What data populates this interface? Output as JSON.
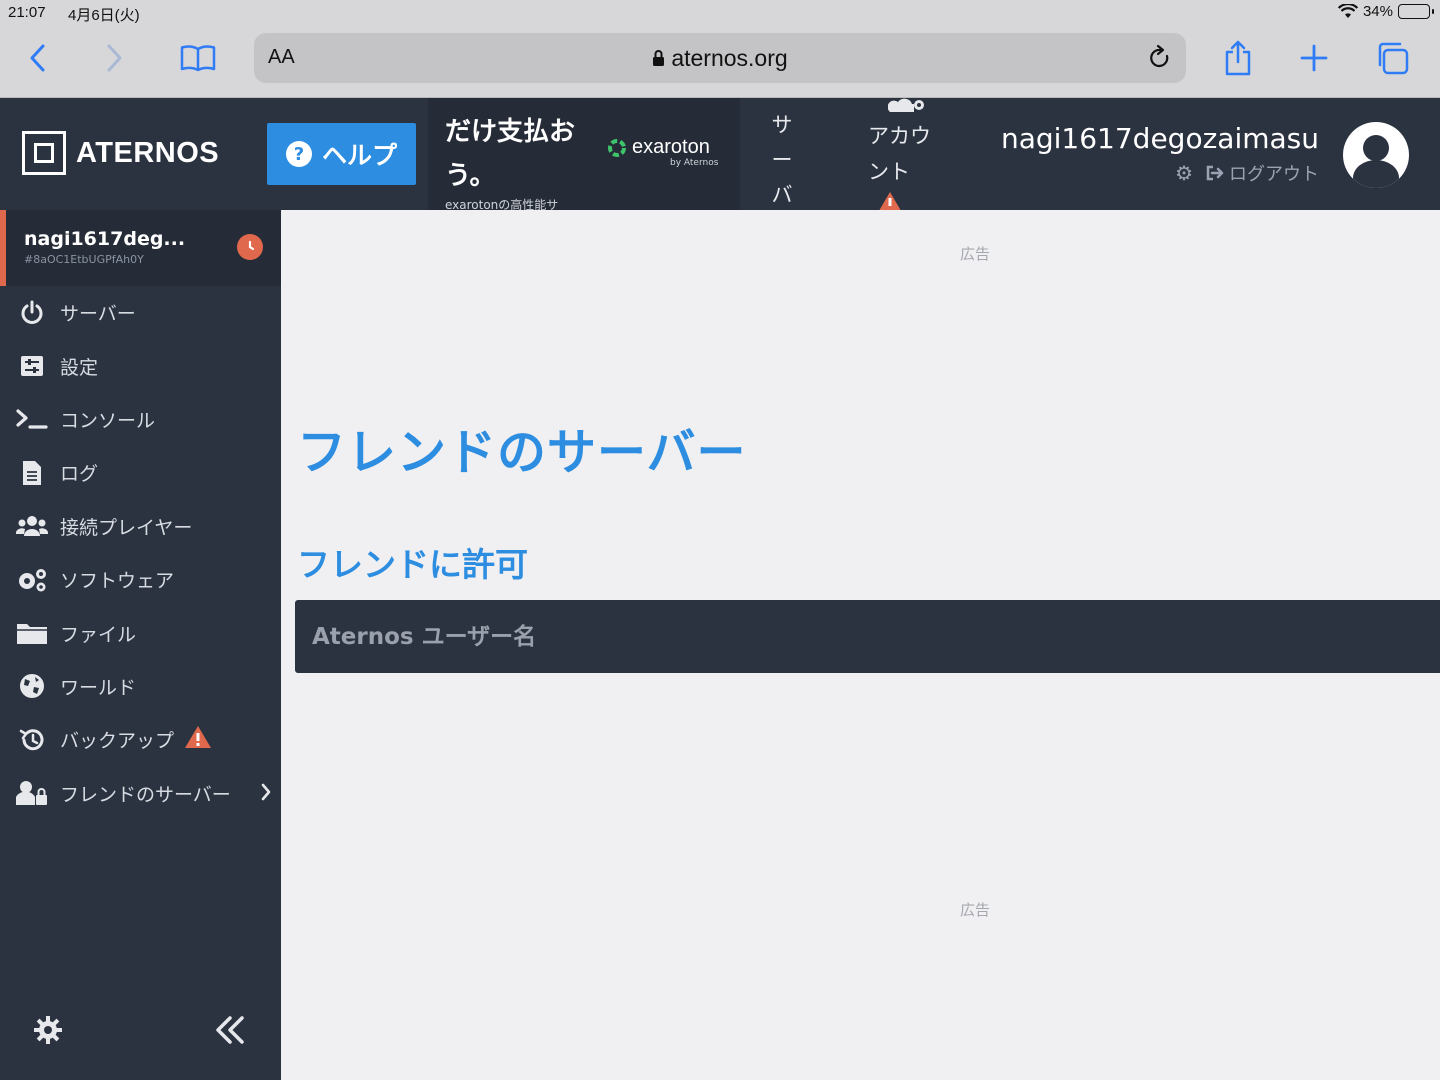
{
  "status_bar": {
    "time": "21:07",
    "date": "4月6日(火)",
    "battery": "34%",
    "battery_level": 0.34
  },
  "browser": {
    "text_size_label": "AA",
    "url": "aternos.org"
  },
  "header": {
    "logo_text": "ATERNOS",
    "help_label": "ヘルプ",
    "ad_text": "だけ支払おう。",
    "ad_subtext": "exarotonの高性能サ",
    "ad_brand": "exaroton",
    "ad_brand_by": "by Aternos",
    "nav_server": [
      "サ",
      "ー",
      "バ"
    ],
    "nav_account": "アカウント",
    "username": "nagi1617degozaimasu",
    "logout_label": "ログアウト"
  },
  "sidebar": {
    "server_name": "nagi1617deg...",
    "server_id": "#8aOC1EtbUGPfAh0Y",
    "items": [
      {
        "label": "サーバー",
        "icon": "power-icon"
      },
      {
        "label": "設定",
        "icon": "sliders-icon"
      },
      {
        "label": "コンソール",
        "icon": "terminal-icon"
      },
      {
        "label": "ログ",
        "icon": "file-icon"
      },
      {
        "label": "接続プレイヤー",
        "icon": "users-icon"
      },
      {
        "label": "ソフトウェア",
        "icon": "cogs-icon"
      },
      {
        "label": "ファイル",
        "icon": "folder-icon"
      },
      {
        "label": "ワールド",
        "icon": "globe-icon"
      },
      {
        "label": "バックアップ",
        "icon": "history-icon"
      },
      {
        "label": "フレンドのサーバー",
        "icon": "user-lock-icon"
      }
    ]
  },
  "main": {
    "ad_label_top": "広告",
    "title": "フレンドのサーバー",
    "section_title": "フレンドに許可",
    "username_placeholder": "Aternos ユーザー名",
    "ad_label_bottom": "広告"
  },
  "colors": {
    "accent": "#2d8de0",
    "header_bg": "#2c3340",
    "warning": "#e0694d",
    "page_bg": "#f0f0f2"
  }
}
